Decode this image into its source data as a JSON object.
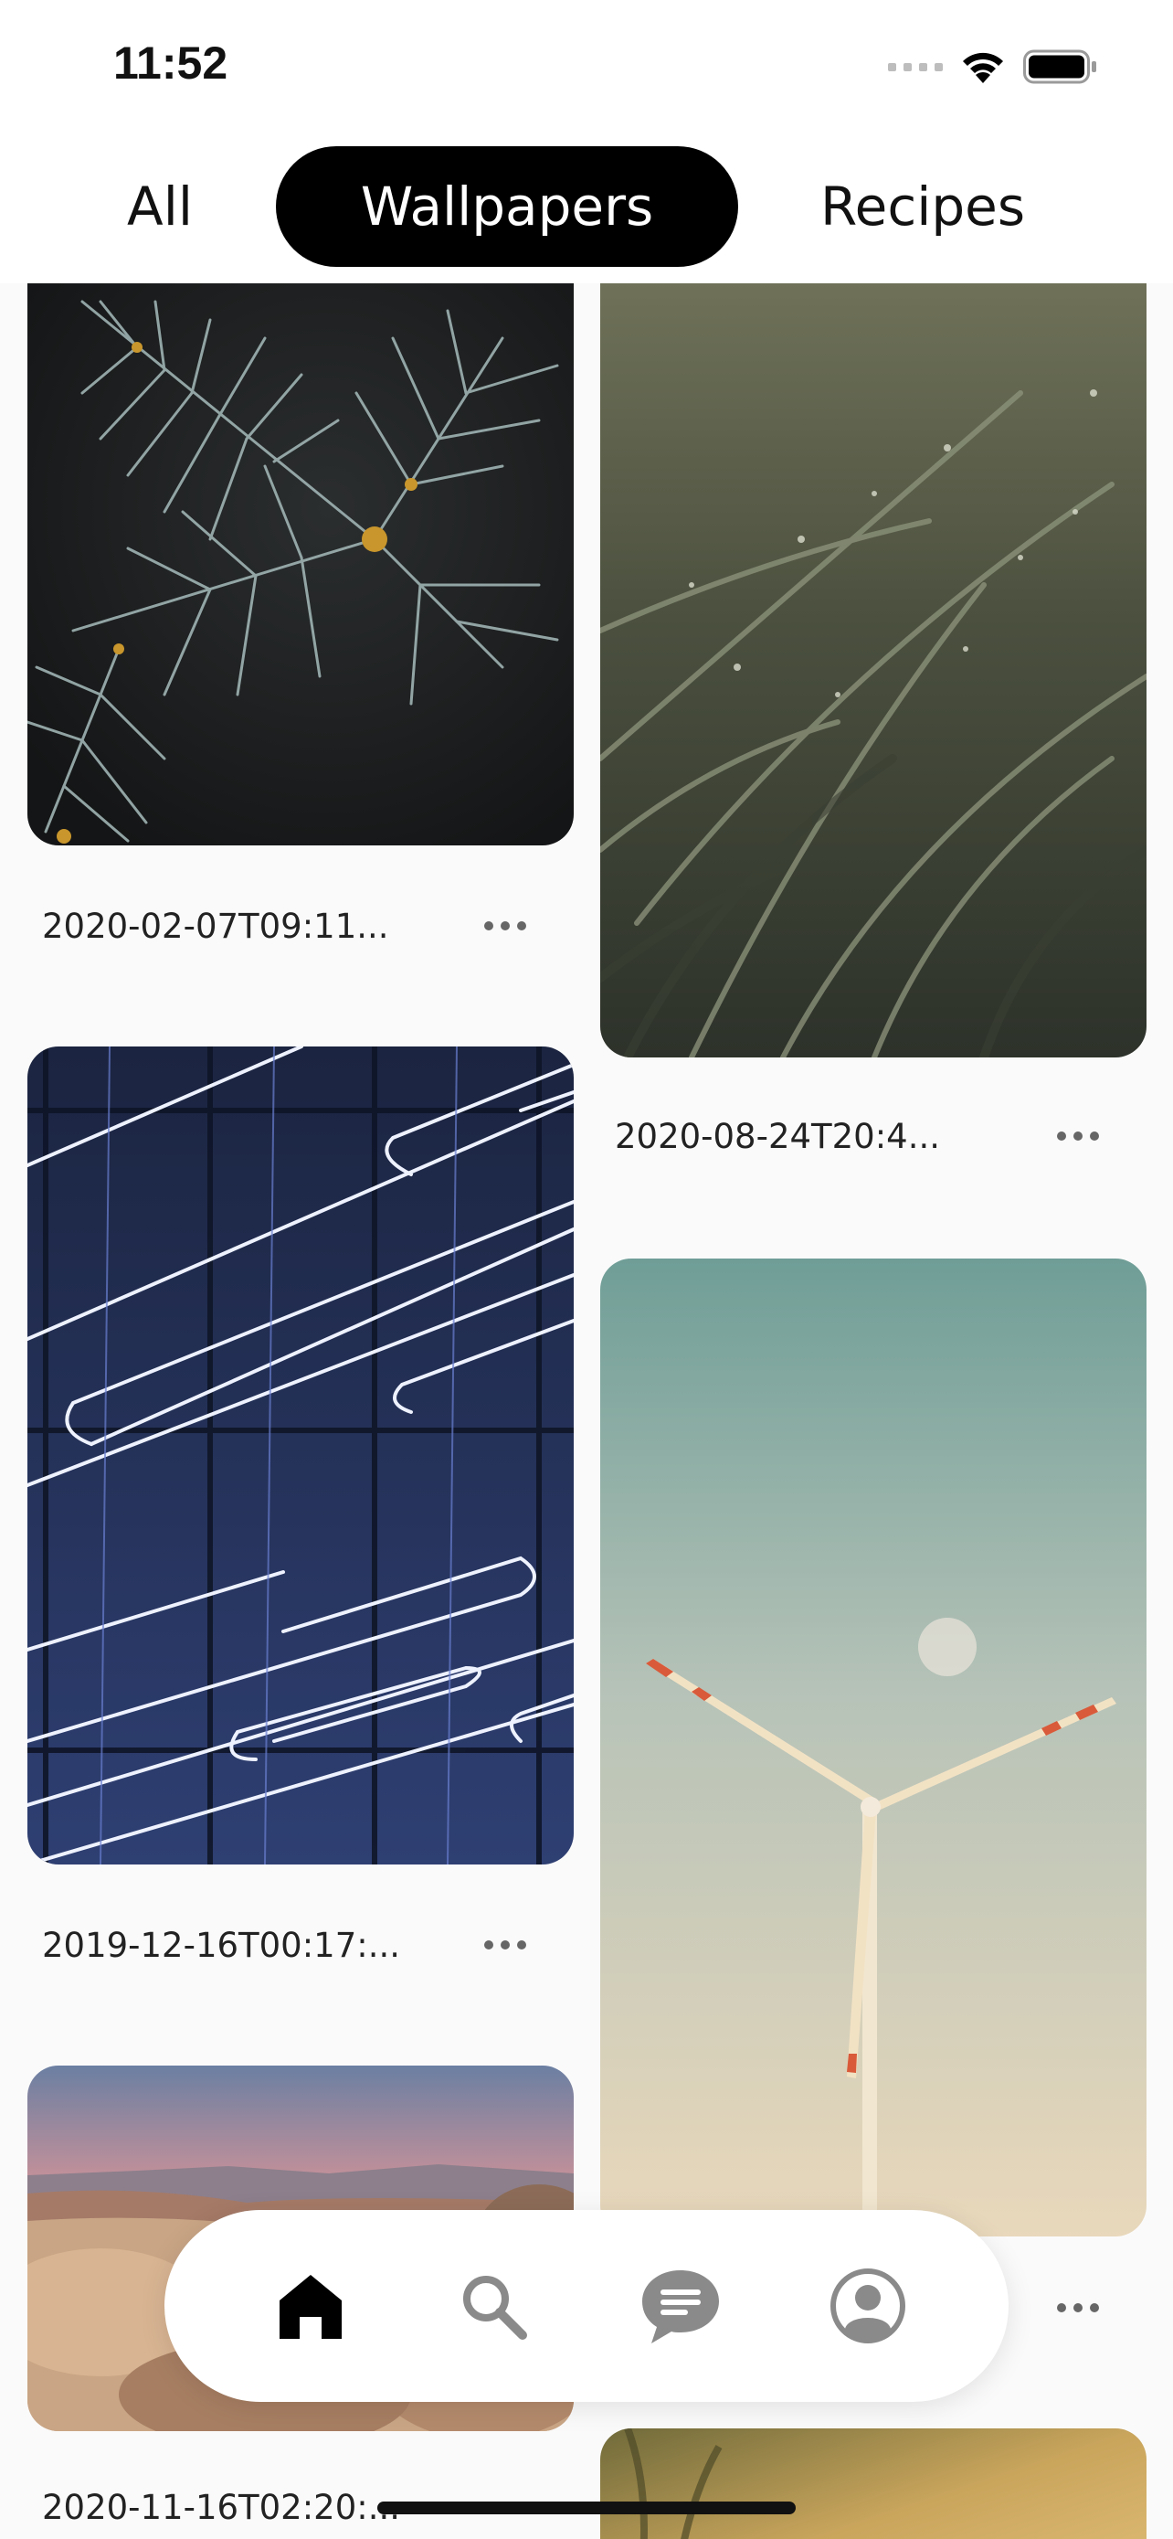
{
  "status_bar": {
    "time": "11:52"
  },
  "tabs": [
    {
      "label": "All",
      "selected": false
    },
    {
      "label": "Wallpapers",
      "selected": true
    },
    {
      "label": "Recipes",
      "selected": false
    }
  ],
  "cards": [
    {
      "id": "pine",
      "caption": "2020-02-07T09:11..."
    },
    {
      "id": "grass",
      "caption": "2020-08-24T20:4..."
    },
    {
      "id": "neon",
      "caption": "2019-12-16T00:17:..."
    },
    {
      "id": "wind-turbine",
      "caption": ""
    },
    {
      "id": "desert",
      "caption": "2020-11-16T02:20:..."
    },
    {
      "id": "field",
      "caption": ""
    }
  ],
  "nav": {
    "items": [
      {
        "icon": "home-icon",
        "selected": true
      },
      {
        "icon": "search-icon",
        "selected": false
      },
      {
        "icon": "message-icon",
        "selected": false
      },
      {
        "icon": "profile-icon",
        "selected": false
      }
    ]
  },
  "colors": {
    "accent": "#000000",
    "background": "#fafafa",
    "inactive_icon": "#8a8a8a"
  }
}
